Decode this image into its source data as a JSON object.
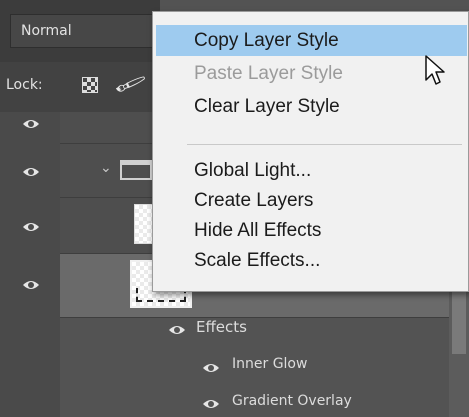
{
  "blend_mode": {
    "value": "Normal"
  },
  "lock": {
    "label": "Lock:"
  },
  "effects": {
    "header": "Effects",
    "items": [
      "Inner Glow",
      "Gradient Overlay"
    ]
  },
  "context_menu": {
    "items": [
      {
        "label": "Copy Layer Style",
        "state": "highlighted"
      },
      {
        "label": "Paste Layer Style",
        "state": "disabled"
      },
      {
        "label": "Clear Layer Style",
        "state": "normal"
      },
      {
        "label": "Global Light...",
        "state": "normal"
      },
      {
        "label": "Create Layers",
        "state": "normal"
      },
      {
        "label": "Hide All Effects",
        "state": "normal"
      },
      {
        "label": "Scale Effects...",
        "state": "normal"
      }
    ]
  },
  "colors": {
    "panel_bg": "#535353",
    "menu_bg": "#f1f1f1",
    "menu_highlight": "#9ecbef",
    "selected_row": "#6a6a6a"
  },
  "icons": [
    "eye-icon",
    "checkerboard-lock-icon",
    "brush-lock-icon",
    "folder-icon",
    "chevron-down-icon",
    "cursor-arrow-icon"
  ]
}
